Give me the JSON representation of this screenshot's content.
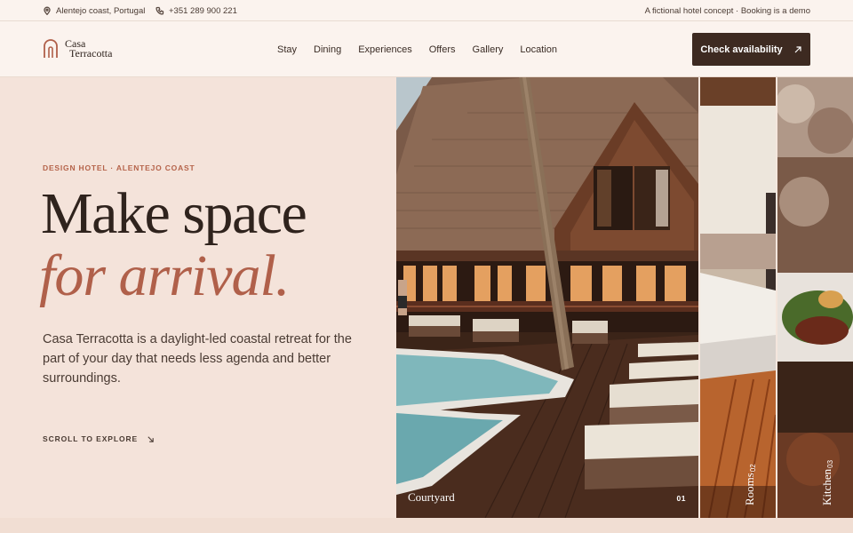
{
  "topbar": {
    "location": "Alentejo coast, Portugal",
    "phone": "+351 289 900 221",
    "note": "A fictional hotel concept · Booking is a demo"
  },
  "header": {
    "logo_line1": "Casa",
    "logo_line2": "Terracotta",
    "nav": [
      "Stay",
      "Dining",
      "Experiences",
      "Offers",
      "Gallery",
      "Location"
    ],
    "cta_label": "Check availability"
  },
  "hero": {
    "eyebrow": "DESIGN HOTEL · ALENTEJO COAST",
    "headline_line1": "Make space",
    "headline_line2": "for arrival.",
    "lede": "Casa Terracotta is a daylight-led coastal retreat for the part of your day that needs less agenda and better surroundings.",
    "scroll_label": "SCROLL TO EXPLORE"
  },
  "gallery": [
    {
      "label": "Courtyard",
      "number": "01"
    },
    {
      "label": "Rooms",
      "number": "02"
    },
    {
      "label": "Kitchen",
      "number": "03"
    }
  ],
  "colors": {
    "accent": "#b0604a",
    "dark": "#3d2a21",
    "background": "#f4e3da"
  }
}
